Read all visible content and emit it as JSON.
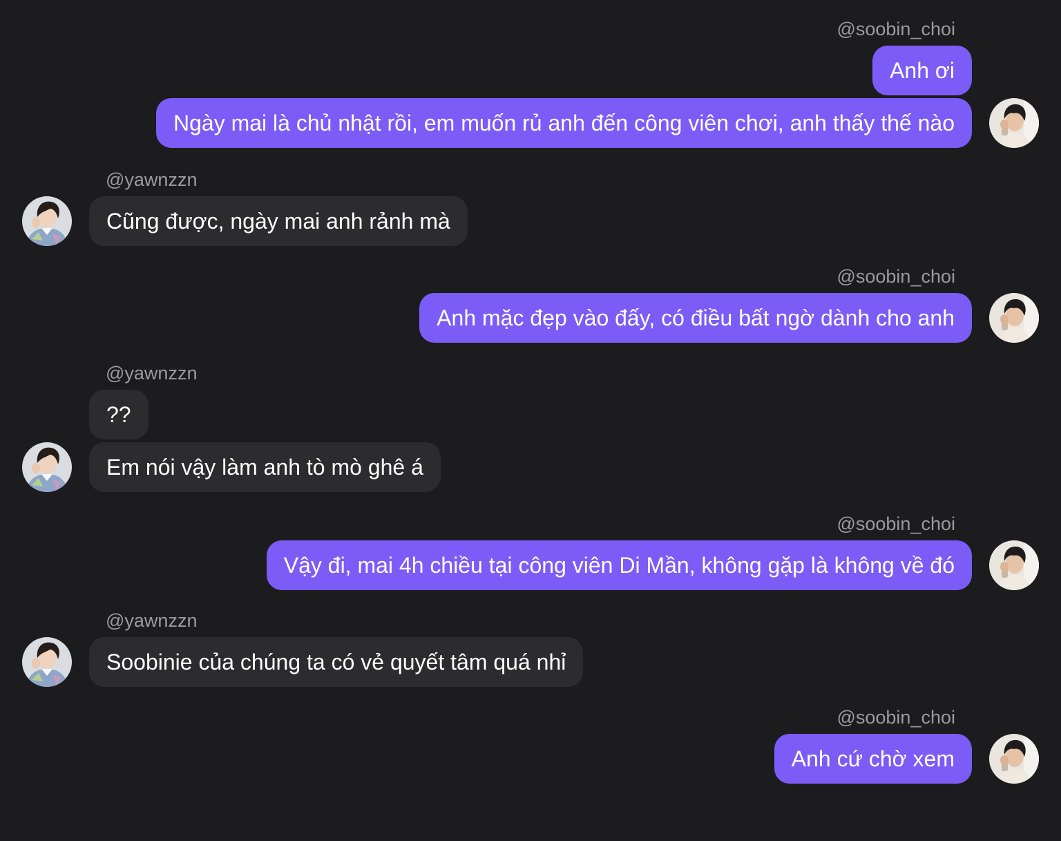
{
  "participants": {
    "me": "@soobin_choi",
    "other": "@yawnzzn"
  },
  "colors": {
    "background": "#1c1c1e",
    "outgoing_bubble": "#7b5cf6",
    "incoming_bubble": "#2c2c2e",
    "username_text": "#9a9aa0",
    "message_text": "#ffffff"
  },
  "messages": [
    {
      "sender": "@soobin_choi",
      "text": "Anh ơi"
    },
    {
      "sender": "@soobin_choi",
      "text": "Ngày mai là chủ nhật rồi, em muốn rủ anh đến công viên chơi, anh thấy thế nào"
    },
    {
      "sender": "@yawnzzn",
      "text": "Cũng được, ngày mai anh rảnh mà"
    },
    {
      "sender": "@soobin_choi",
      "text": "Anh mặc đẹp vào đấy, có điều bất ngờ dành cho anh"
    },
    {
      "sender": "@yawnzzn",
      "text": "??"
    },
    {
      "sender": "@yawnzzn",
      "text": "Em nói vậy làm anh tò mò ghê á"
    },
    {
      "sender": "@soobin_choi",
      "text": "Vậy đi, mai 4h chiều tại công viên Di Mần, không gặp là không về đó"
    },
    {
      "sender": "@yawnzzn",
      "text": "Soobinie của chúng ta có vẻ quyết tâm quá nhỉ"
    },
    {
      "sender": "@soobin_choi",
      "text": "Anh cứ chờ xem"
    }
  ]
}
